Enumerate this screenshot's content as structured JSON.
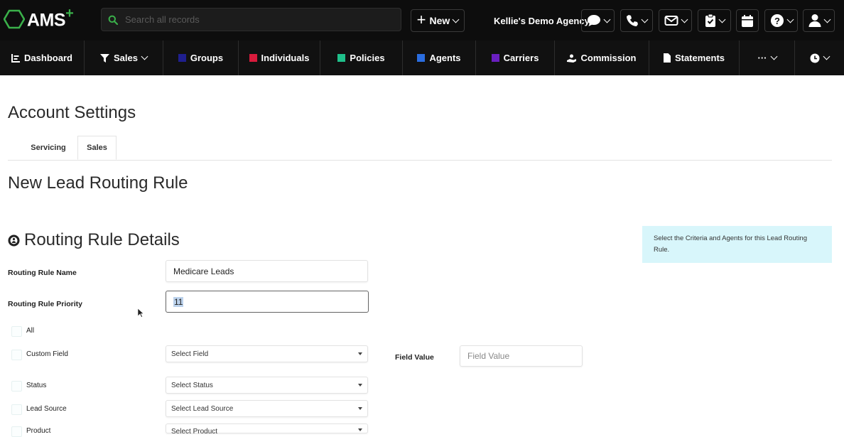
{
  "app": {
    "logo_text": "AMS",
    "logo_plus": "+",
    "search_placeholder": "Search all records",
    "new_label": "New",
    "agency_name": "Kellie's Demo Agency",
    "colors": {
      "brand_green": "#3ab04a",
      "topbar": "#0d0d0d",
      "info_bg": "#d8f6fb"
    }
  },
  "toolbar_icons": [
    "chat-icon",
    "phone-icon",
    "mail-icon",
    "clipboard-icon",
    "calendar-icon",
    "help-icon",
    "user-icon"
  ],
  "nav": {
    "items": [
      {
        "label": "Dashboard",
        "icon": "dashboard-icon"
      },
      {
        "label": "Sales",
        "icon": "filter-icon"
      },
      {
        "label": "Groups",
        "color": "#1f1f8f"
      },
      {
        "label": "Individuals",
        "color": "#d81b3c"
      },
      {
        "label": "Policies",
        "color": "#1fc08a"
      },
      {
        "label": "Agents",
        "color": "#2a6de0"
      },
      {
        "label": "Carriers",
        "color": "#6a1fc0"
      },
      {
        "label": "Commission",
        "icon": "commission-icon"
      },
      {
        "label": "Statements",
        "icon": "document-icon"
      },
      {
        "label": "···"
      },
      {
        "label": "",
        "icon": "clock-icon"
      }
    ]
  },
  "page": {
    "title": "Account Settings",
    "tabs": [
      "Servicing",
      "Sales"
    ],
    "active_tab": "Sales",
    "subtitle": "New Lead Routing Rule",
    "section_title": "Routing Rule Details",
    "info_text": "Select the Criteria and Agents for this Lead Routing Rule."
  },
  "form": {
    "rule_name_label": "Routing Rule Name",
    "rule_name_value": "Medicare Leads",
    "priority_label": "Routing Rule Priority",
    "priority_value": "11",
    "all_label": "All",
    "custom_field_label": "Custom Field",
    "custom_field_select": "Select Field",
    "field_value_label": "Field Value",
    "field_value_placeholder": "Field Value",
    "status_label": "Status",
    "status_select": "Select Status",
    "lead_source_label": "Lead Source",
    "lead_source_select": "Select Lead Source",
    "product_label": "Product",
    "product_select": "Select Product"
  }
}
